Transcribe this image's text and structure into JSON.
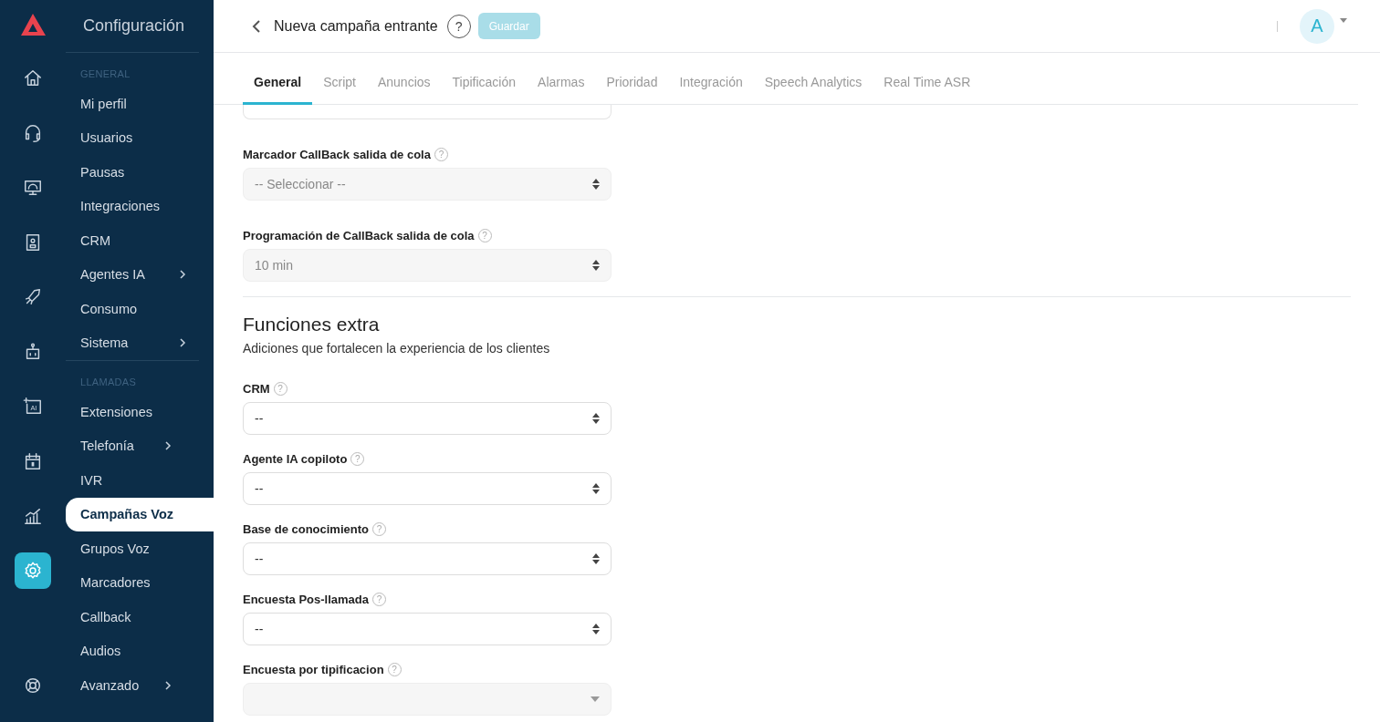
{
  "sidebar": {
    "title": "Configuración",
    "rail": [
      {
        "kind": "home",
        "selected": false
      },
      {
        "kind": "headset",
        "selected": false
      },
      {
        "kind": "monitor",
        "selected": false
      },
      {
        "kind": "contacts",
        "selected": false
      },
      {
        "kind": "rocket",
        "selected": false
      },
      {
        "kind": "robot",
        "selected": false
      },
      {
        "kind": "ai",
        "selected": false,
        "text": "AI"
      },
      {
        "kind": "calendar",
        "selected": false
      },
      {
        "kind": "chart",
        "selected": false
      },
      {
        "kind": "gear",
        "selected": true
      }
    ],
    "sections": [
      {
        "heading": "GENERAL",
        "items": [
          {
            "label": "Mi perfil",
            "selected": false,
            "submenu": false
          },
          {
            "label": "Usuarios",
            "selected": false,
            "submenu": false
          },
          {
            "label": "Pausas",
            "selected": false,
            "submenu": false
          },
          {
            "label": "Integraciones",
            "selected": false,
            "submenu": false
          },
          {
            "label": "CRM",
            "selected": false,
            "submenu": false
          },
          {
            "label": "Agentes IA",
            "selected": false,
            "submenu": true
          },
          {
            "label": "Consumo",
            "selected": false,
            "submenu": false
          },
          {
            "label": "Sistema",
            "selected": false,
            "submenu": true
          }
        ]
      },
      {
        "heading": "LLAMADAS",
        "items": [
          {
            "label": "Extensiones",
            "selected": false,
            "submenu": false
          },
          {
            "label": "Telefonía",
            "selected": false,
            "submenu": true
          },
          {
            "label": "IVR",
            "selected": false,
            "submenu": false
          },
          {
            "label": "Campañas Voz",
            "selected": true,
            "submenu": false
          },
          {
            "label": "Grupos Voz",
            "selected": false,
            "submenu": false
          },
          {
            "label": "Marcadores",
            "selected": false,
            "submenu": false
          },
          {
            "label": "Callback",
            "selected": false,
            "submenu": false
          },
          {
            "label": "Audios",
            "selected": false,
            "submenu": false
          },
          {
            "label": "Avanzado",
            "selected": false,
            "submenu": true
          }
        ]
      }
    ]
  },
  "header": {
    "title": "Nueva campaña entrante",
    "help": "?",
    "save": {
      "label": "Guardar",
      "disabled": true
    },
    "avatar": "A"
  },
  "tabs": [
    {
      "label": "General",
      "selected": true
    },
    {
      "label": "Script",
      "selected": false
    },
    {
      "label": "Anuncios",
      "selected": false
    },
    {
      "label": "Tipificación",
      "selected": false
    },
    {
      "label": "Alarmas",
      "selected": false
    },
    {
      "label": "Prioridad",
      "selected": false
    },
    {
      "label": "Integración",
      "selected": false
    },
    {
      "label": "Speech Analytics",
      "selected": false
    },
    {
      "label": "Real Time ASR",
      "selected": false
    }
  ],
  "fields_top": [
    {
      "label": "Marcador CallBack salida de cola",
      "value": "-- Seleccionar --",
      "help": "?",
      "disabled": true,
      "kind": "stepper"
    },
    {
      "label": "Programación de CallBack salida de cola",
      "value": "10 min",
      "help": "?",
      "disabled": true,
      "kind": "stepper"
    }
  ],
  "section": {
    "title": "Funciones extra",
    "subtitle": "Adiciones que fortalecen la experiencia de los clientes"
  },
  "fields": [
    {
      "label": "CRM",
      "value": "--",
      "help": "?",
      "disabled": false,
      "kind": "stepper"
    },
    {
      "label": "Agente IA copiloto",
      "value": "--",
      "help": "?",
      "disabled": false,
      "kind": "stepper"
    },
    {
      "label": "Base de conocimiento",
      "value": "--",
      "help": "?",
      "disabled": false,
      "kind": "stepper"
    },
    {
      "label": "Encuesta Pos-llamada",
      "value": "--",
      "help": "?",
      "disabled": false,
      "kind": "stepper"
    },
    {
      "label": "Encuesta por tipificacion",
      "help": "?",
      "disabled": true,
      "kind": "caret"
    }
  ]
}
